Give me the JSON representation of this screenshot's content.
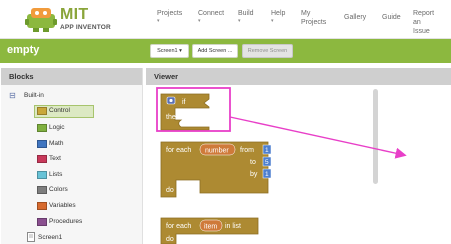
{
  "app": {
    "logo_title": "MIT",
    "logo_subtitle": "APP INVENTOR"
  },
  "nav": [
    {
      "label": "Projects",
      "has_caret": true
    },
    {
      "label": "Connect",
      "has_caret": true
    },
    {
      "label": "Build",
      "has_caret": true
    },
    {
      "label": "Help",
      "has_caret": true
    },
    {
      "label": "My\nProjects",
      "has_caret": false
    },
    {
      "label": "Gallery",
      "has_caret": false
    },
    {
      "label": "Guide",
      "has_caret": false
    },
    {
      "label": "Report an\nIssue",
      "has_caret": false
    }
  ],
  "project": {
    "name": "empty",
    "screen_select": "Screen1 ▾",
    "add_screen": "Add Screen ...",
    "remove_screen": "Remove Screen"
  },
  "blocks_panel": {
    "title": "Blocks",
    "root_label": "Built-in",
    "root_toggle": "⊟",
    "categories": [
      {
        "label": "Control",
        "color": "#c9a83a"
      },
      {
        "label": "Logic",
        "color": "#7fb03f"
      },
      {
        "label": "Math",
        "color": "#3f75c0"
      },
      {
        "label": "Text",
        "color": "#c8385a"
      },
      {
        "label": "Lists",
        "color": "#67c2d6"
      },
      {
        "label": "Colors",
        "color": "#7d7d7d"
      },
      {
        "label": "Variables",
        "color": "#d6692d"
      },
      {
        "label": "Procedures",
        "color": "#8a4f8f"
      }
    ],
    "screen_item": "Screen1"
  },
  "viewer": {
    "title": "Viewer",
    "blocks": {
      "if_label": "if",
      "then_label": "then",
      "foreach_label": "for each",
      "number_var": "number",
      "from_label": "from",
      "from_value": "1",
      "to_label": "to",
      "to_value": "5",
      "by_label": "by",
      "by_value": "1",
      "do_label": "do",
      "foreach_item_prefix": "for each",
      "item_var": "item",
      "in_list_label": "in list",
      "do_label_2": "do"
    }
  },
  "colors": {
    "brand_green": "#8cb83f",
    "control_block": "#ad8a32",
    "annotation": "#e83fc8",
    "number_block": "#4d7fcf"
  }
}
